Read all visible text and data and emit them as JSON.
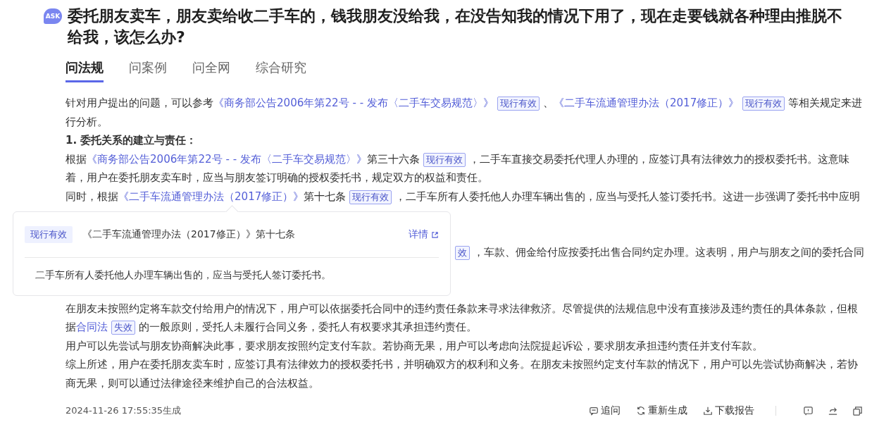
{
  "question": {
    "badge": "ASK",
    "title": "委托朋友卖车，朋友卖给收二手车的，钱我朋友没给我，在没告知我的情况下用了，现在走要钱就各种理由推脱不给我，该怎么办?"
  },
  "tabs": [
    {
      "label": "问法规",
      "selected": true
    },
    {
      "label": "问案例",
      "selected": false
    },
    {
      "label": "问全网",
      "selected": false
    },
    {
      "label": "综合研究",
      "selected": false
    }
  ],
  "answer": [
    {
      "kind": "para",
      "segments": [
        {
          "kind": "text",
          "text": "针对用户提出的问题，可以参考"
        },
        {
          "kind": "link",
          "text": "《商务部公告2006年第22号 - - 发布〈二手车交易规范〉》"
        },
        {
          "kind": "tag",
          "text": "现行有效"
        },
        {
          "kind": "text",
          "text": "、"
        },
        {
          "kind": "link",
          "text": "《二手车流通管理办法（2017修正）》"
        },
        {
          "kind": "tag",
          "text": "现行有效"
        },
        {
          "kind": "text",
          "text": "等相关规定来进行分析。"
        }
      ]
    },
    {
      "kind": "para",
      "segments": [
        {
          "kind": "bold",
          "text": "1. 委托关系的建立与责任："
        }
      ]
    },
    {
      "kind": "para",
      "segments": [
        {
          "kind": "text",
          "text": "根据"
        },
        {
          "kind": "link",
          "text": "《商务部公告2006年第22号 - - 发布〈二手车交易规范〉》"
        },
        {
          "kind": "text",
          "text": "第三十六条"
        },
        {
          "kind": "tag",
          "text": "现行有效"
        },
        {
          "kind": "text",
          "text": "，二手车直接交易委托代理人办理的，应签订具有法律效力的授权委托书。这意味着，用户在委托朋友卖车时，应当与朋友签订明确的授权委托书，规定双方的权益和责任。"
        }
      ]
    },
    {
      "kind": "para",
      "segments": [
        {
          "kind": "text",
          "text": "同时，根据"
        },
        {
          "kind": "link",
          "text": "《二手车流通管理办法（2017修正）》"
        },
        {
          "kind": "text",
          "text": "第十七条"
        },
        {
          "kind": "tag",
          "text": "现行有效"
        },
        {
          "kind": "text",
          "text": "，二手车所有人委托他人办理车辆出售的，应当与受托人签订委托书。这进一步强调了委托书中应明"
        }
      ]
    },
    {
      "kind": "covered"
    },
    {
      "kind": "covered"
    },
    {
      "kind": "fragment",
      "segments": [
        {
          "kind": "tag",
          "text": "效"
        },
        {
          "kind": "text",
          "text": "，车款、佣金给付应按委托出售合同约定办理。这表明，用户与朋友之间的委托合同"
        }
      ]
    },
    {
      "kind": "covered"
    },
    {
      "kind": "covered"
    },
    {
      "kind": "para",
      "segments": [
        {
          "kind": "text",
          "text": "在朋友未按照约定将车款交付给用户的情况下，用户可以依据委托合同中的违约责任条款来寻求法律救济。尽管提供的法规信息中没有直接涉及违约责任的具体条款，但根据"
        },
        {
          "kind": "link",
          "text": "合同法"
        },
        {
          "kind": "tag",
          "text": "失效"
        },
        {
          "kind": "text",
          "text": "的一般原则，受托人未履行合同义务，委托人有权要求其承担违约责任。"
        }
      ]
    },
    {
      "kind": "para",
      "segments": [
        {
          "kind": "text",
          "text": "用户可以先尝试与朋友协商解决此事，要求朋友按照约定支付车款。若协商无果，用户可以考虑向法院提起诉讼，要求朋友承担违约责任并支付车款。"
        }
      ]
    },
    {
      "kind": "para",
      "segments": [
        {
          "kind": "text",
          "text": "综上所述，用户在委托朋友卖车时，应签订具有法律效力的授权委托书，并明确双方的权利和义务。在朋友未按照约定支付车款的情况下，用户可以先尝试协商解决，若协商无果，则可以通过法律途径来维护自己的合法权益。"
        }
      ]
    }
  ],
  "popover": {
    "tag": "现行有效",
    "title": "《二手车流通管理办法（2017修正）》第十七条",
    "link": "详情",
    "body": "二手车所有人委托他人办理车辆出售的，应当与受托人签订委托书。"
  },
  "footer": {
    "timestamp": "2024-11-26 17:55:35生成",
    "actions": [
      {
        "kind": "ask",
        "label": "追问"
      },
      {
        "kind": "regen",
        "label": "重新生成"
      },
      {
        "kind": "download",
        "label": "下载报告"
      }
    ],
    "icons": [
      {
        "kind": "feedback"
      },
      {
        "kind": "share"
      },
      {
        "kind": "copy"
      }
    ]
  }
}
